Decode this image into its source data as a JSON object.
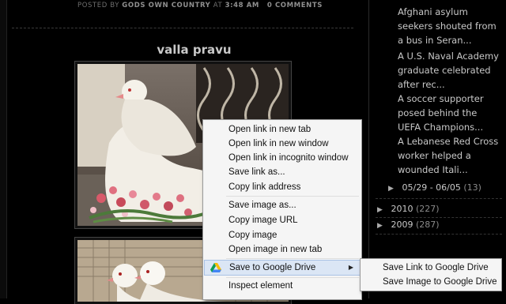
{
  "post": {
    "meta_prefix": "Posted by",
    "author": "Gods Own Country",
    "at": "at",
    "time": "3:48 AM",
    "comments": "0 Comments",
    "title": "valla pravu"
  },
  "sidebar": {
    "news": [
      {
        "text": "Afghani asylum seekers shouted from a bus in Seran..."
      },
      {
        "text": "A U.S. Naval Academy graduate celebrated after rec..."
      },
      {
        "text": "A soccer supporter posed behind the UEFA Champions..."
      },
      {
        "text": "A Lebanese Red Cross worker helped a wounded Itali..."
      }
    ],
    "archive": [
      {
        "label": "05/29 - 06/05",
        "count": "(13)",
        "triangle": "▶"
      },
      {
        "label": "2010",
        "count": "(227)",
        "triangle": "▶"
      },
      {
        "label": "2009",
        "count": "(287)",
        "triangle": "▶"
      }
    ]
  },
  "context_menu": {
    "group1": [
      "Open link in new tab",
      "Open link in new window",
      "Open link in incognito window",
      "Save link as...",
      "Copy link address"
    ],
    "group2": [
      "Save image as...",
      "Copy image URL",
      "Copy image",
      "Open image in new tab"
    ],
    "google_drive": "Save to Google Drive",
    "google_drive_arrow": "▶",
    "inspect": "Inspect element"
  },
  "submenu": {
    "items": [
      "Save Link to Google Drive",
      "Save Image to Google Drive"
    ]
  },
  "icons": {
    "drive": "google-drive-icon",
    "archive_expand": "triangle-right-icon"
  },
  "colors": {
    "background": "#000000",
    "menu_highlight": "#dbe6f5",
    "text_light": "#c8c8c8"
  }
}
